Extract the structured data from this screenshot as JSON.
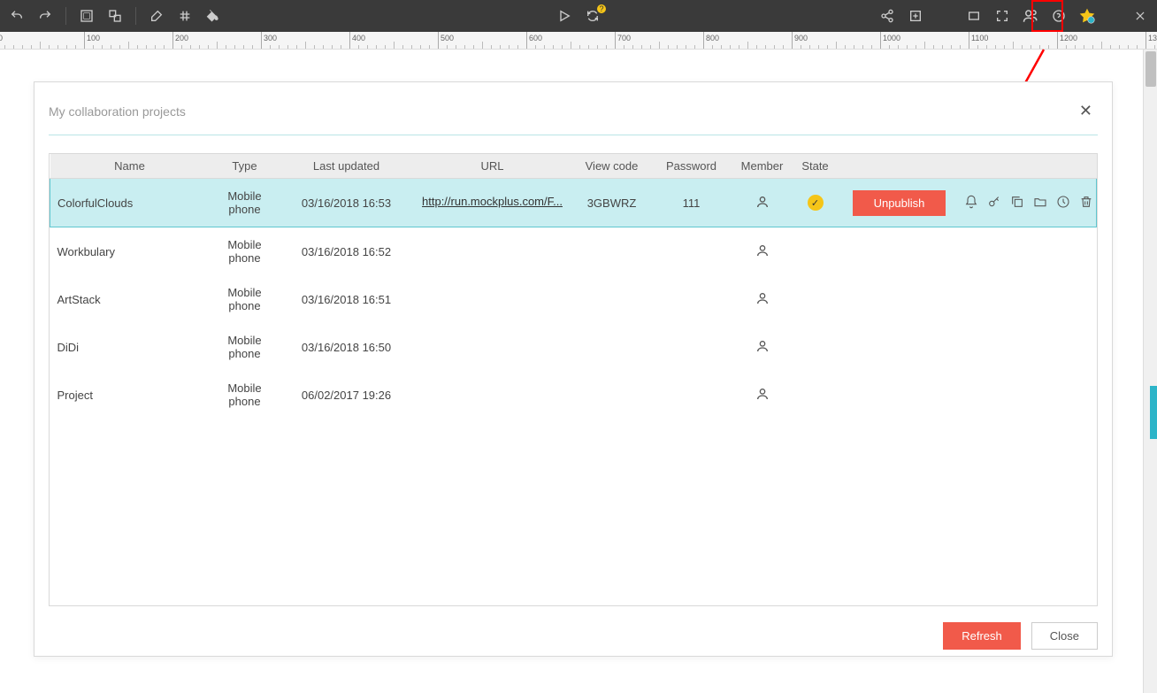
{
  "dialog": {
    "title": "My collaboration projects",
    "refresh_label": "Refresh",
    "close_label": "Close",
    "unpublish_label": "Unpublish"
  },
  "table": {
    "headers": {
      "name": "Name",
      "type": "Type",
      "updated": "Last updated",
      "url": "URL",
      "viewcode": "View code",
      "password": "Password",
      "member": "Member",
      "state": "State"
    },
    "rows": [
      {
        "name": "ColorfulClouds",
        "type": "Mobile phone",
        "updated": "03/16/2018 16:53",
        "url": "http://run.mockplus.com/F...",
        "viewcode": "3GBWRZ",
        "password": "111",
        "state": true,
        "selected": true
      },
      {
        "name": "Workbulary",
        "type": "Mobile phone",
        "updated": "03/16/2018 16:52",
        "url": "",
        "viewcode": "",
        "password": "",
        "state": false,
        "selected": false
      },
      {
        "name": "ArtStack",
        "type": "Mobile phone",
        "updated": "03/16/2018 16:51",
        "url": "",
        "viewcode": "",
        "password": "",
        "state": false,
        "selected": false
      },
      {
        "name": "DiDi",
        "type": "Mobile phone",
        "updated": "03/16/2018 16:50",
        "url": "",
        "viewcode": "",
        "password": "",
        "state": false,
        "selected": false
      },
      {
        "name": "Project",
        "type": "Mobile phone",
        "updated": "06/02/2017 19:26",
        "url": "",
        "viewcode": "",
        "password": "",
        "state": false,
        "selected": false
      }
    ]
  },
  "ruler": {
    "start": 0,
    "end": 1400,
    "major": 100
  }
}
